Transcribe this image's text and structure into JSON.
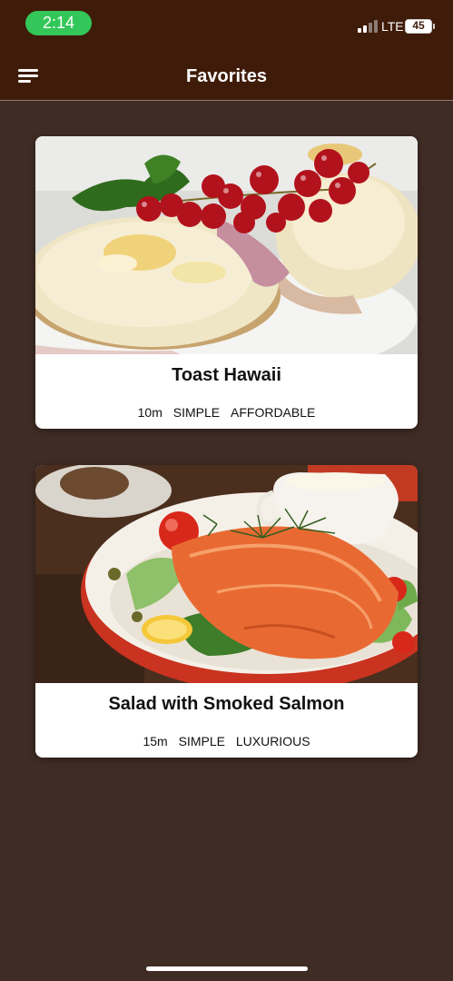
{
  "status_bar": {
    "time": "2:14",
    "network": "LTE",
    "battery": "45"
  },
  "header": {
    "title": "Favorites",
    "menu_icon": "hamburger-menu-icon"
  },
  "meals": [
    {
      "title": "Toast Hawaii",
      "duration": "10m",
      "complexity": "SIMPLE",
      "affordability": "AFFORDABLE"
    },
    {
      "title": "Salad with Smoked Salmon",
      "duration": "15m",
      "complexity": "SIMPLE",
      "affordability": "LUXURIOUS"
    }
  ],
  "colors": {
    "header_background": "#3f1c09",
    "page_background": "#3f2c24",
    "time_pill": "#33c759",
    "card_background": "#ffffff"
  }
}
